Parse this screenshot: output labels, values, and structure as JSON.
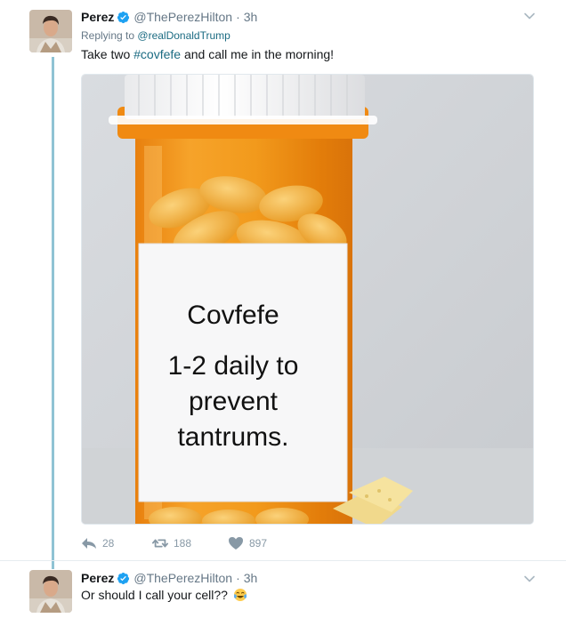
{
  "tweets": [
    {
      "author": {
        "name": "Perez",
        "handle": "@ThePerezHilton",
        "verified": true
      },
      "time": "3h",
      "reply_prefix": "Replying to",
      "reply_to": "@realDonaldTrump",
      "text_before": "Take two",
      "hashtag": "#covfefe",
      "text_after": "and call me in the morning!",
      "media": {
        "label_line1": "Covfefe",
        "label_line2": "1-2 daily to",
        "label_line3": "prevent",
        "label_line4": "tantrums."
      },
      "stats": {
        "replies": "28",
        "retweets": "188",
        "likes": "897"
      }
    },
    {
      "author": {
        "name": "Perez",
        "handle": "@ThePerezHilton",
        "verified": true
      },
      "time": "3h",
      "text": "Or should I call your cell??",
      "emoji": "face-with-tears-of-joy"
    }
  ],
  "colors": {
    "accent": "#1b6b82",
    "thread_line": "#8fc3d4",
    "muted": "#657786",
    "verified": "#1da1f2"
  }
}
